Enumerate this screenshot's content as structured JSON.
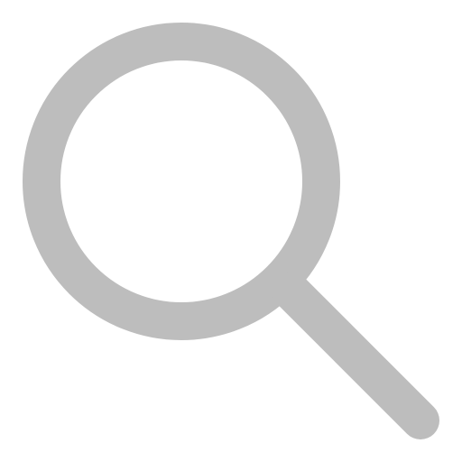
{
  "icon": {
    "name": "search-icon",
    "color": "#bdbdbd",
    "background": "#ffffff"
  }
}
